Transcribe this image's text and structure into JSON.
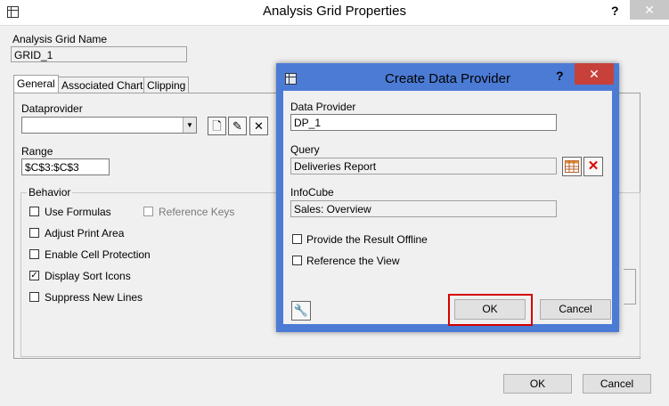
{
  "outer": {
    "title": "Analysis Grid Properties",
    "help": "?",
    "close": "✕",
    "grid_name_label": "Analysis Grid Name",
    "grid_name_value": "GRID_1",
    "tabs": [
      {
        "label": "General"
      },
      {
        "label": "Associated Charts"
      },
      {
        "label": "Clipping"
      }
    ],
    "dataprovider_label": "Dataprovider",
    "dataprovider_value": "",
    "range_label": "Range",
    "range_value": "$C$3:$C$3",
    "behavior_label": "Behavior",
    "checkboxes": [
      {
        "label": "Use Formulas",
        "checked": false
      },
      {
        "label": "Adjust Print Area",
        "checked": false
      },
      {
        "label": "Enable Cell Protection",
        "checked": false
      },
      {
        "label": "Display Sort Icons",
        "checked": true
      },
      {
        "label": "Suppress New Lines",
        "checked": false
      }
    ],
    "reference_keys": {
      "label": "Reference Keys",
      "checked": false
    },
    "ok": "OK",
    "cancel": "Cancel"
  },
  "inner": {
    "title": "Create Data Provider",
    "help": "?",
    "close": "✕",
    "data_provider_label": "Data Provider",
    "data_provider_value": "DP_1",
    "query_label": "Query",
    "query_value": "Deliveries Report",
    "infocube_label": "InfoCube",
    "infocube_value": "Sales: Overview",
    "checkboxes": [
      {
        "label": "Provide the Result Offline",
        "checked": false
      },
      {
        "label": "Reference the View",
        "checked": false
      }
    ],
    "ok": "OK",
    "cancel": "Cancel"
  },
  "colors": {
    "dialog_border": "#4b7bd5",
    "close_red": "#c7413a",
    "highlight": "#d40000"
  }
}
